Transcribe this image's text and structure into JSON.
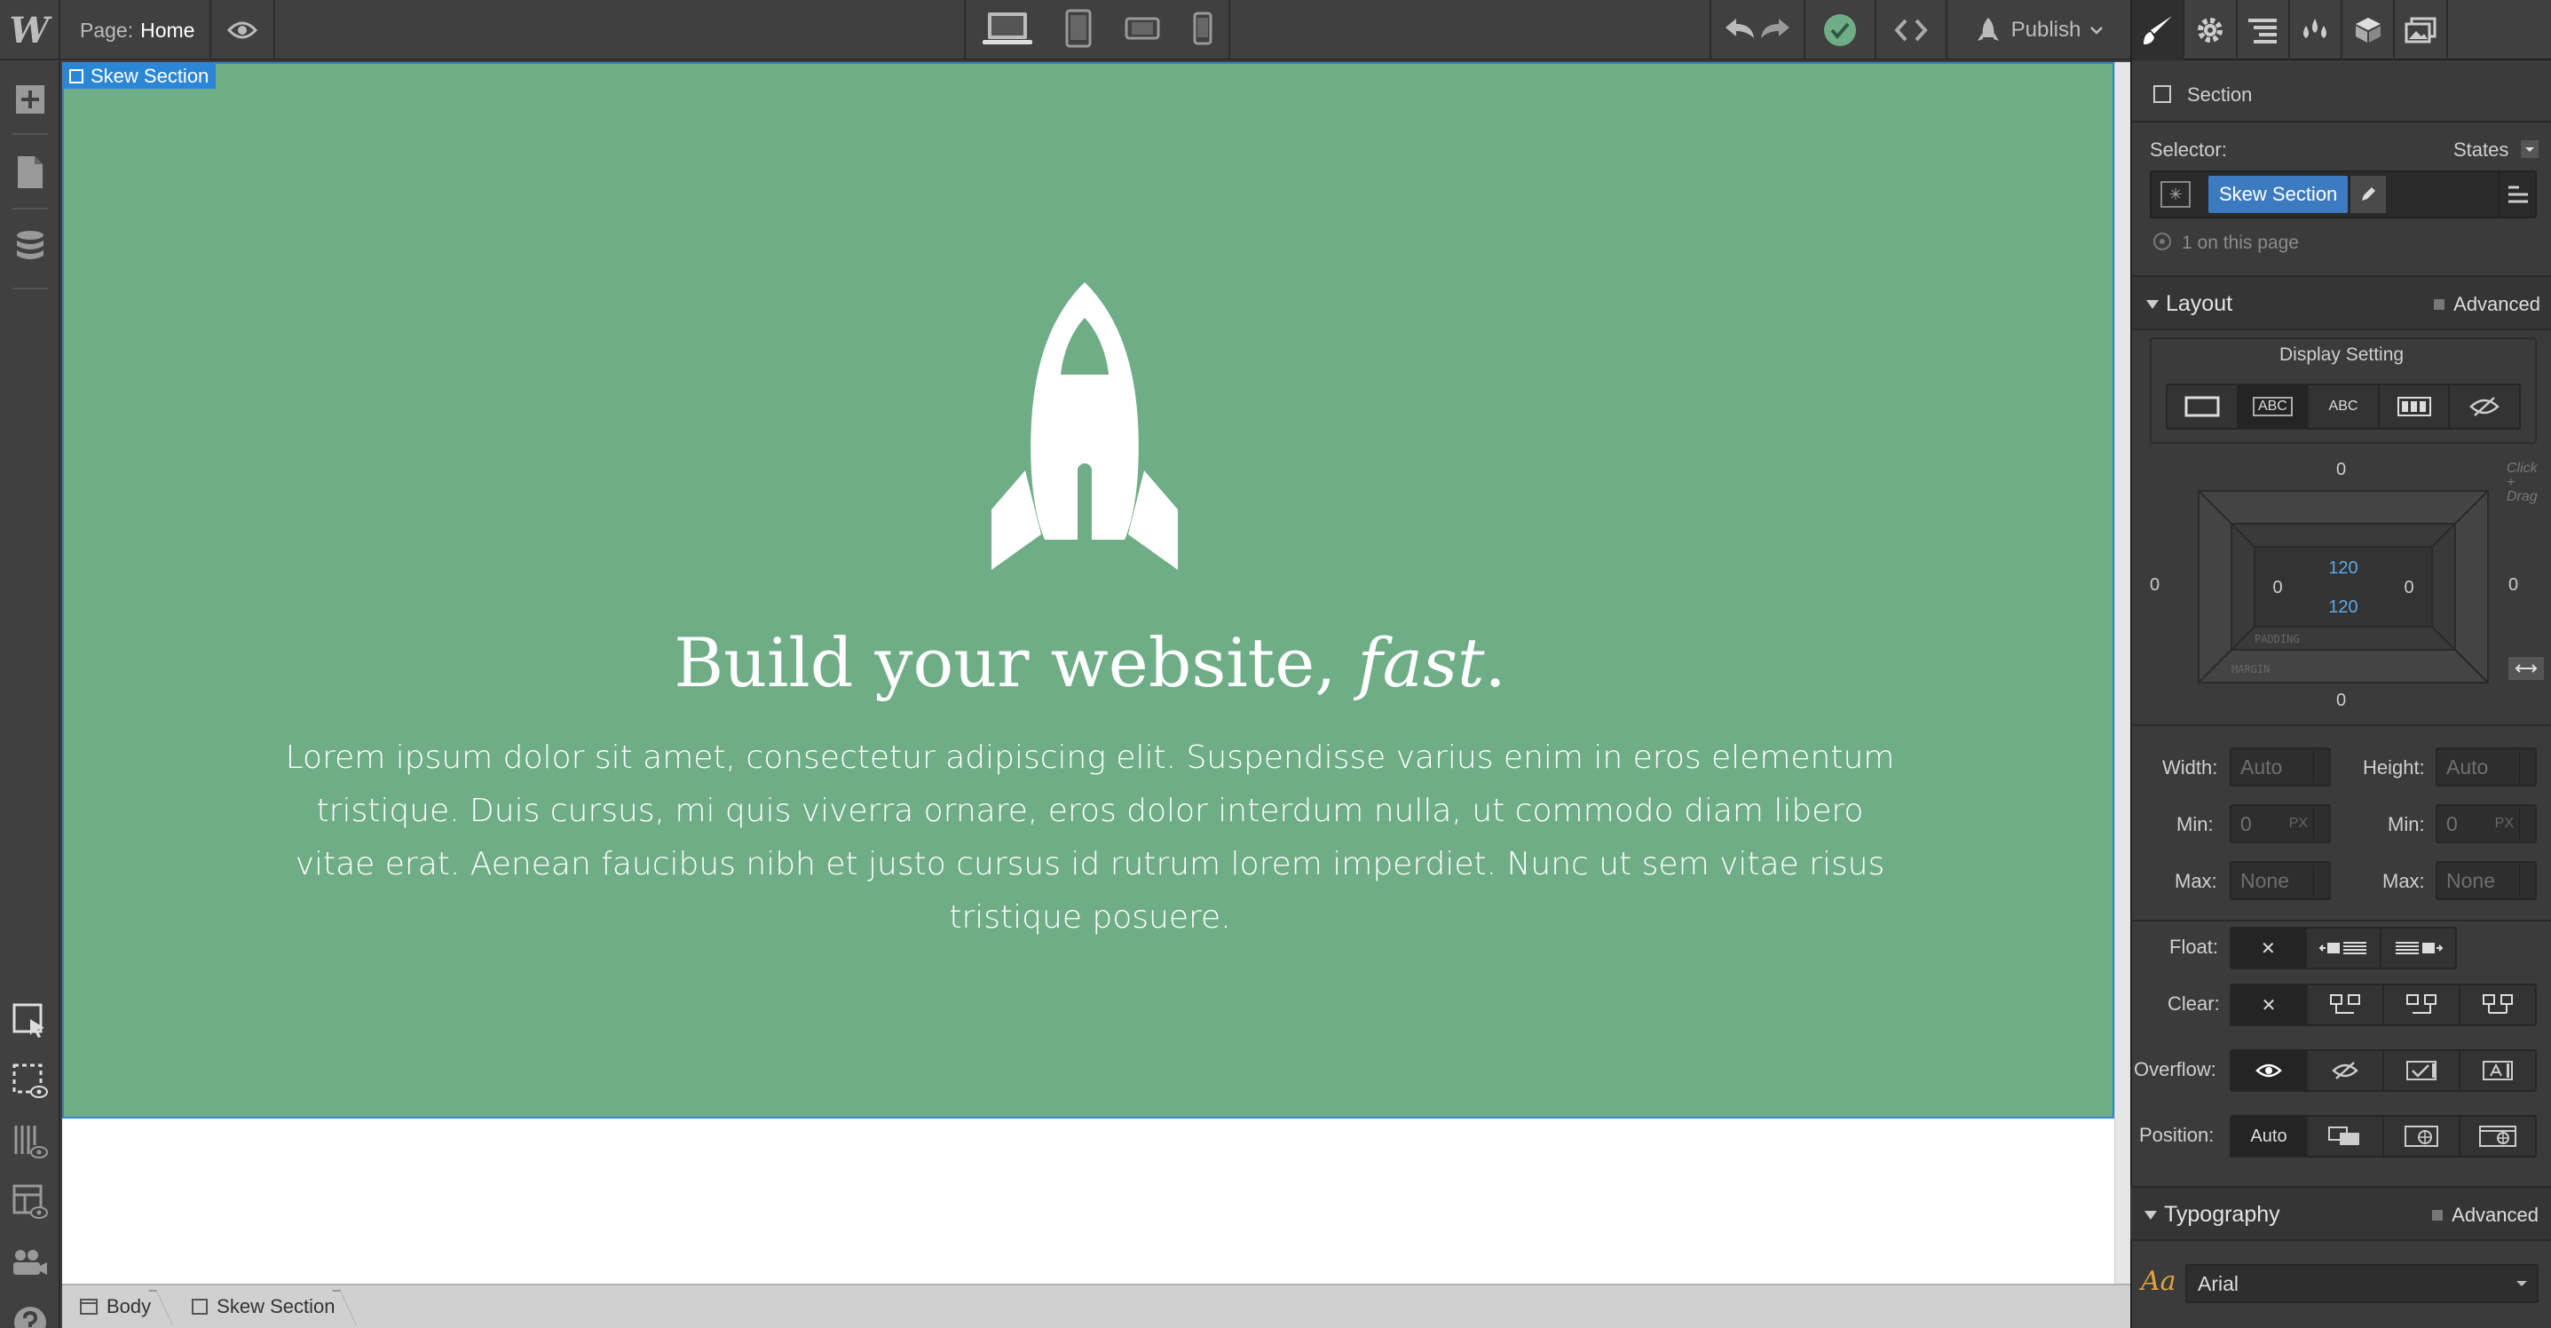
{
  "topbar": {
    "logo": "W",
    "page_label": "Page:",
    "page_name": "Home",
    "publish_label": "Publish"
  },
  "canvas": {
    "selected_label": "Skew Section",
    "headline_main": "Build your website, ",
    "headline_em": "fast",
    "headline_end": ".",
    "paragraph": "Lorem ipsum dolor sit amet, consectetur adipiscing elit. Suspendisse varius enim in eros elementum tristique. Duis cursus, mi quis viverra ornare, eros dolor interdum nulla, ut commodo diam libero vitae erat. Aenean faucibus nibh et justo cursus id rutrum lorem imperdiet. Nunc ut sem vitae risus tristique posuere."
  },
  "breadcrumb": [
    "Body",
    "Skew Section"
  ],
  "panel": {
    "element_type": "Section",
    "selector_label": "Selector:",
    "states_label": "States",
    "selector_class": "Skew Section",
    "on_page": "1 on this page",
    "layout": {
      "title": "Layout",
      "advanced": "Advanced",
      "display_setting": "Display Setting",
      "display_abc1": "ABC",
      "display_abc2": "ABC",
      "margin_top": "0",
      "margin_bottom": "0",
      "margin_left": "0",
      "margin_right": "0",
      "padding_top": "120",
      "padding_bottom": "120",
      "padding_left": "0",
      "padding_right": "0",
      "padding_label": "PADDING",
      "margin_label": "MARGIN",
      "click_drag": "Click + Drag",
      "width_label": "Width:",
      "width_value": "Auto",
      "height_label": "Height:",
      "height_value": "Auto",
      "min_label": "Min:",
      "min_w_value": "0",
      "min_h_value": "0",
      "unit_px": "PX",
      "max_label": "Max:",
      "max_w_value": "None",
      "max_h_value": "None",
      "float_label": "Float:",
      "clear_label": "Clear:",
      "overflow_label": "Overflow:",
      "position_label": "Position:",
      "position_auto": "Auto"
    },
    "typography": {
      "title": "Typography",
      "advanced": "Advanced",
      "font": "Arial"
    }
  },
  "colors": {
    "hero_bg": "#6fad87",
    "selection": "#2b86d6",
    "publish_ok": "#6fad87"
  }
}
